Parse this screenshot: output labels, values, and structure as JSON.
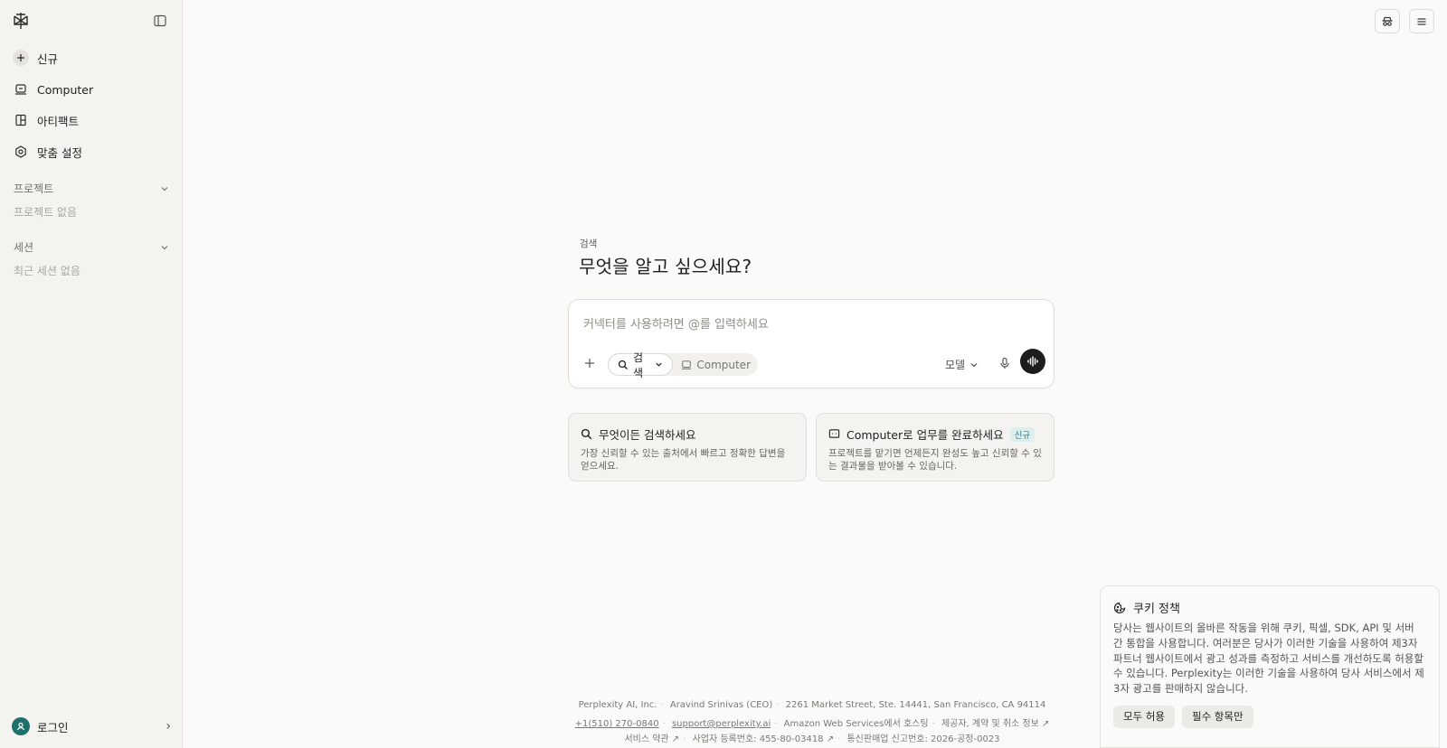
{
  "sidebar": {
    "items": [
      {
        "label": "신규",
        "icon": "plus-icon"
      },
      {
        "label": "Computer",
        "icon": "computer-icon"
      },
      {
        "label": "아티팩트",
        "icon": "artifact-icon"
      },
      {
        "label": "맞춤 설정",
        "icon": "settings-hex-icon"
      }
    ],
    "projects": {
      "title": "프로젝트",
      "empty": "프로젝트 없음"
    },
    "sessions": {
      "title": "세션",
      "empty": "최근 세션 없음"
    },
    "login_label": "로그인"
  },
  "hero": {
    "label": "검색",
    "title": "무엇을 알고 싶으세요?"
  },
  "composer": {
    "placeholder": "커넥터를 사용하려면 @를 입력하세요",
    "mode_selected": "검색",
    "mode_other": "Computer",
    "model_label": "모델"
  },
  "cards": [
    {
      "title": "무엇이든 검색하세요",
      "desc": "가장 신뢰할 수 있는 출처에서 빠르고 정확한 답변을 얻으세요.",
      "icon": "search-icon"
    },
    {
      "title": "Computer로 업무를 완료하세요",
      "badge": "신규",
      "desc": "프로젝트를 맡기면 언제든지 완성도 높고 신뢰할 수 있는 결과물을 받아볼 수 있습니다.",
      "icon": "computer-icon"
    }
  ],
  "footer": {
    "company": "Perplexity AI, Inc.",
    "ceo": "Aravind Srinivas (CEO)",
    "address": "2261 Market Street, Ste. 14441, San Francisco, CA 94114",
    "phone": "+1(510) 270-0840",
    "email": "support@perplexity.ai",
    "hosting": "Amazon Web Services에서 호스팅",
    "provider": "제공자, 계약 및 취소 정보 ↗",
    "terms": "서비스 약관 ↗",
    "biz_no": "사업자 등록번호: 455-80-03418 ↗",
    "ecommerce_no": "통신판매업 신고번호: 2026-공정-0023"
  },
  "cookie": {
    "title": "쿠키 정책",
    "body": "당사는 웹사이트의 올바른 작동을 위해 쿠키, 픽셀, SDK, API 및 서버 간 통합을 사용합니다. 여러분은 당사가 이러한 기술을 사용하여 제3자 파트너 웹사이트에서 광고 성과를 측정하고 서비스를 개선하도록 허용할 수 있습니다. Perplexity는 이러한 기술을 사용하여 당사 서비스에서 제3자 광고를 판매하지 않습니다.",
    "accept_all": "모두 허용",
    "essential_only": "필수 항목만"
  }
}
